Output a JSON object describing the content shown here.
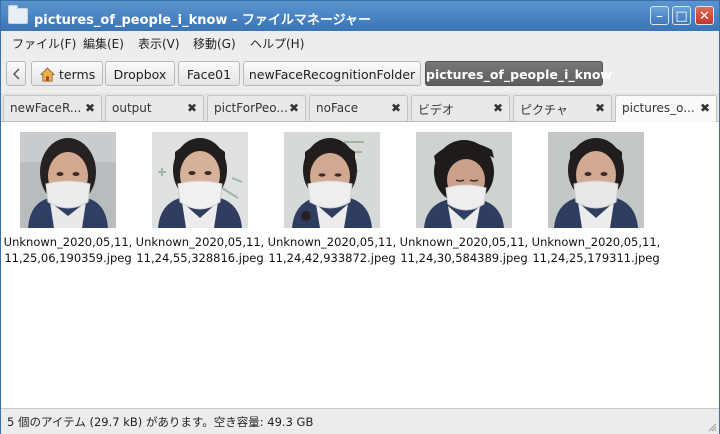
{
  "window": {
    "title": "pictures_of_people_i_know - ファイルマネージャー",
    "minimize": "–",
    "maximize": "□",
    "close": "✕"
  },
  "menu": [
    "ファイル(F)",
    "編集(E)",
    "表示(V)",
    "移動(G)",
    "ヘルプ(H)"
  ],
  "breadcrumb": [
    "terms",
    "Dropbox",
    "Face01",
    "newFaceRecognitionFolder",
    "pictures_of_people_i_know"
  ],
  "tabs": [
    {
      "label": "newFaceR...",
      "close": "✖"
    },
    {
      "label": "output",
      "close": "✖"
    },
    {
      "label": "pictForPeo...",
      "close": "✖"
    },
    {
      "label": "noFace",
      "close": "✖"
    },
    {
      "label": "ビデオ",
      "close": "✖"
    },
    {
      "label": "ピクチャ",
      "close": "✖"
    },
    {
      "label": "pictures_o...",
      "close": "✖"
    }
  ],
  "files": [
    {
      "line1": "Unknown_2020,05,11,",
      "line2": "11,25,06,190359.jpeg"
    },
    {
      "line1": "Unknown_2020,05,11,",
      "line2": "11,24,55,328816.jpeg"
    },
    {
      "line1": "Unknown_2020,05,11,",
      "line2": "11,24,42,933872.jpeg"
    },
    {
      "line1": "Unknown_2020,05,11,",
      "line2": "11,24,30,584389.jpeg"
    },
    {
      "line1": "Unknown_2020,05,11,",
      "line2": "11,24,25,179311.jpeg"
    }
  ],
  "status": "5 個のアイテム (29.7 kB) があります。空き容量: 49.3 GB",
  "icons": {
    "folder": "folder-icon",
    "home": "home-icon",
    "close_tab": "close-icon"
  },
  "colors": {
    "titlebar": "#3b74b6",
    "active_crumb": "#5e5e5e"
  }
}
